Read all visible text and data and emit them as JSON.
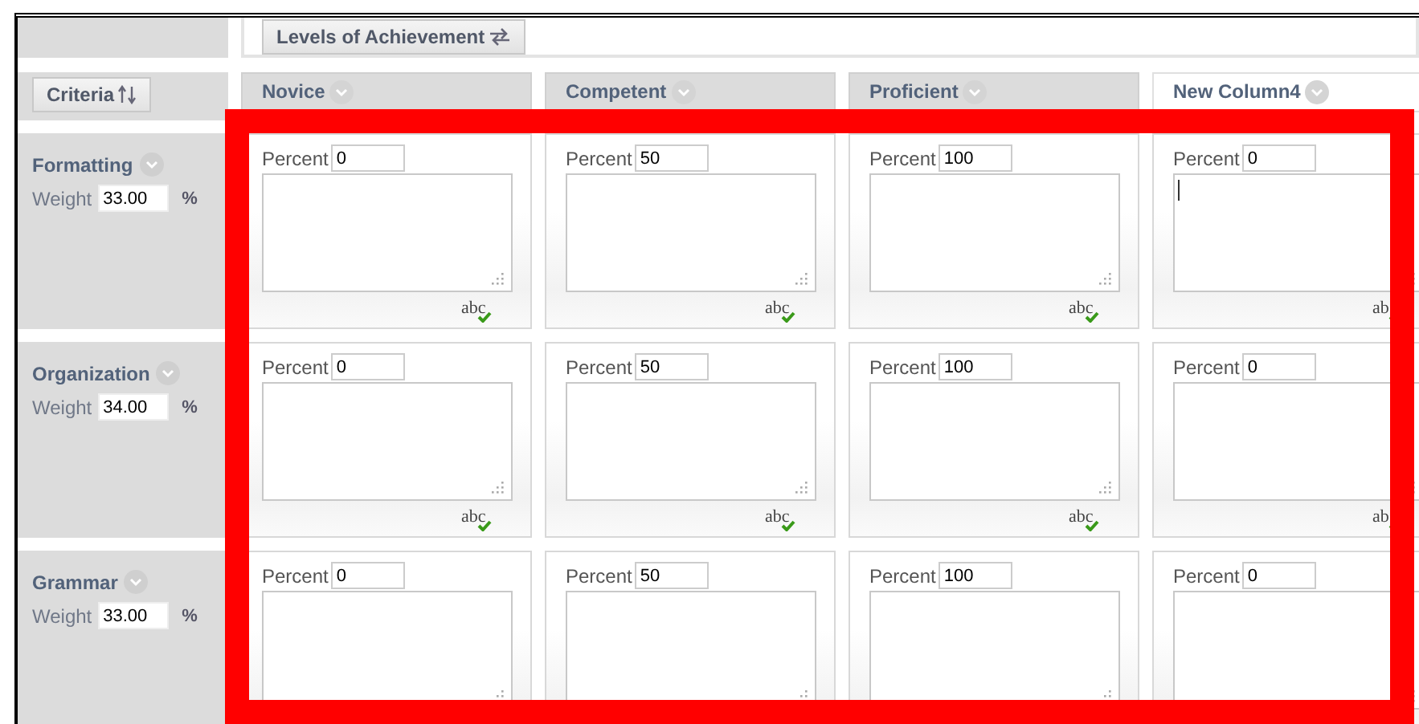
{
  "toolbar": {
    "levels_button": "Levels of Achievement"
  },
  "criteria_button": "Criteria",
  "columns": [
    {
      "title": "Novice",
      "highlighted": false
    },
    {
      "title": "Competent",
      "highlighted": false
    },
    {
      "title": "Proficient",
      "highlighted": false
    },
    {
      "title": "New Column4",
      "highlighted": true
    }
  ],
  "criteria": [
    {
      "name": "Formatting",
      "weight_label": "Weight",
      "weight": "33.00",
      "unit": "%",
      "cells": [
        {
          "label": "Percent",
          "percent": "0",
          "spellcheck": "abc",
          "focused": false
        },
        {
          "label": "Percent",
          "percent": "50",
          "spellcheck": "abc",
          "focused": false
        },
        {
          "label": "Percent",
          "percent": "100",
          "spellcheck": "abc",
          "focused": false
        },
        {
          "label": "Percent",
          "percent": "0",
          "spellcheck": "ab",
          "focused": true
        }
      ]
    },
    {
      "name": "Organization",
      "weight_label": "Weight",
      "weight": "34.00",
      "unit": "%",
      "cells": [
        {
          "label": "Percent",
          "percent": "0",
          "spellcheck": "abc",
          "focused": false
        },
        {
          "label": "Percent",
          "percent": "50",
          "spellcheck": "abc",
          "focused": false
        },
        {
          "label": "Percent",
          "percent": "100",
          "spellcheck": "abc",
          "focused": false
        },
        {
          "label": "Percent",
          "percent": "0",
          "spellcheck": "ab",
          "focused": false
        }
      ]
    },
    {
      "name": "Grammar",
      "weight_label": "Weight",
      "weight": "33.00",
      "unit": "%",
      "cells": [
        {
          "label": "Percent",
          "percent": "0",
          "focused": false
        },
        {
          "label": "Percent",
          "percent": "50",
          "focused": false
        },
        {
          "label": "Percent",
          "percent": "100",
          "focused": false
        },
        {
          "label": "Percent",
          "percent": "0",
          "focused": false
        }
      ]
    }
  ]
}
